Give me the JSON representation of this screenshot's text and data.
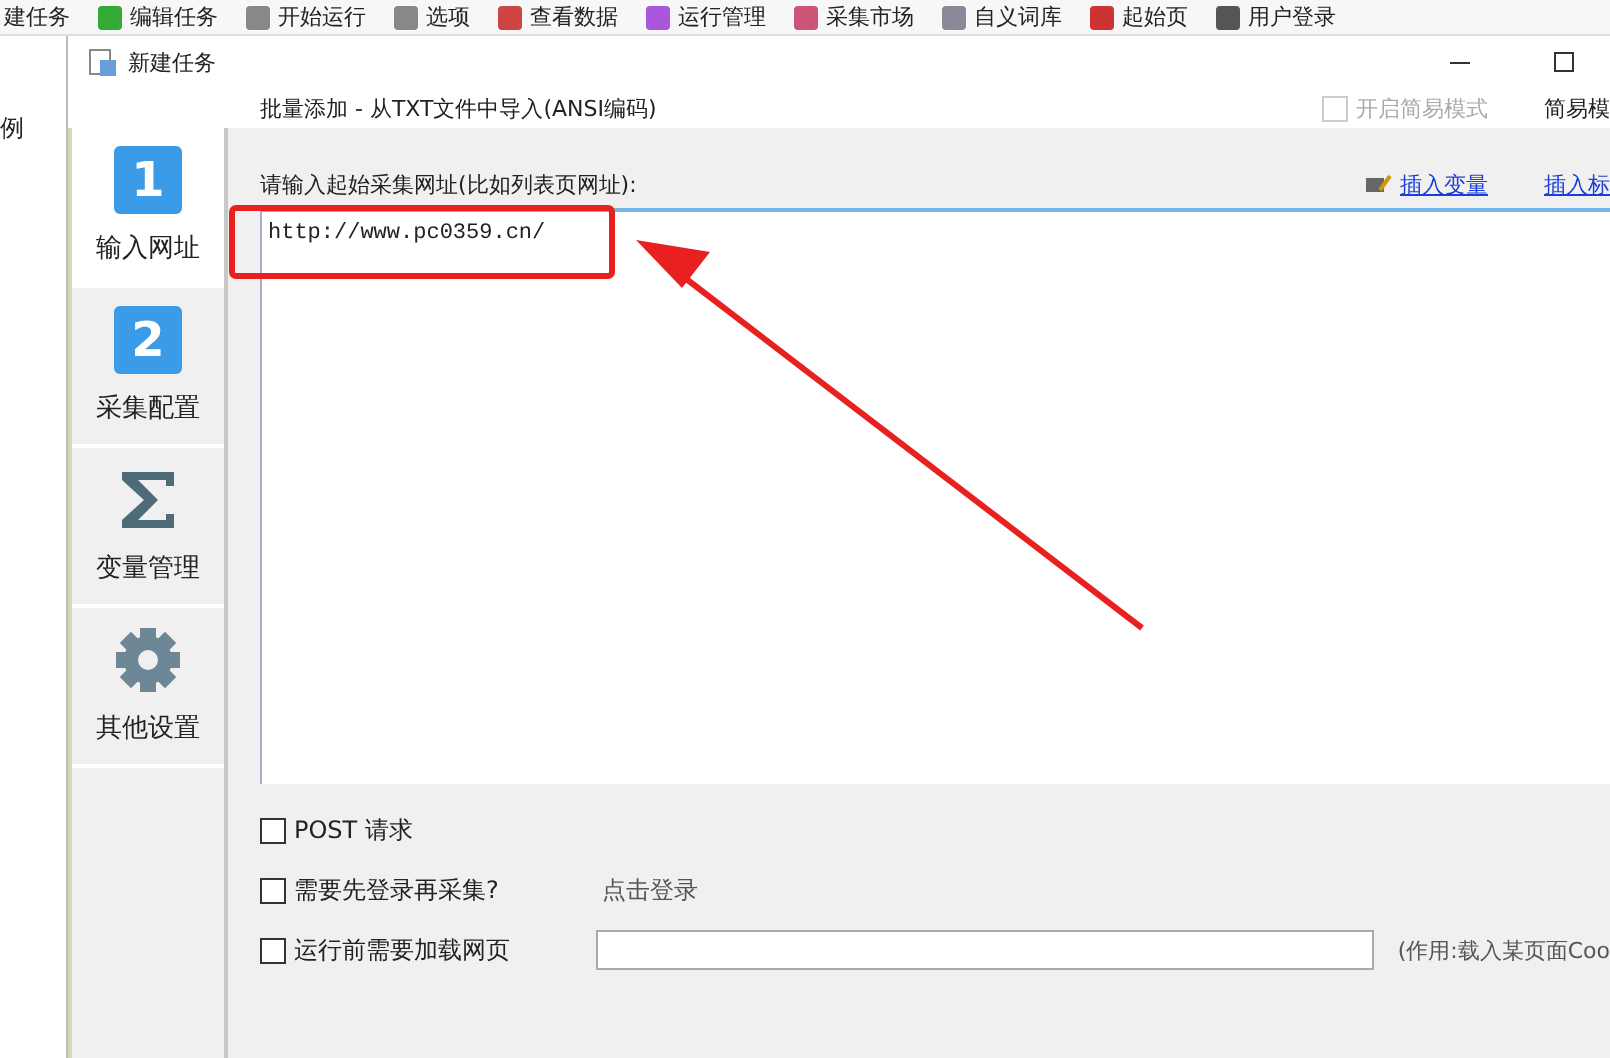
{
  "app_toolbar": {
    "items": [
      {
        "label": "建任务"
      },
      {
        "label": "编辑任务"
      },
      {
        "label": "开始运行"
      },
      {
        "label": "选项"
      },
      {
        "label": "查看数据"
      },
      {
        "label": "运行管理"
      },
      {
        "label": "采集市场"
      },
      {
        "label": "自义词库"
      },
      {
        "label": "起始页"
      },
      {
        "label": "用户登录"
      }
    ]
  },
  "left_panel": {
    "text": "例"
  },
  "dialog": {
    "title": "新建任务",
    "batch_add": "批量添加 - 从TXT文件中导入(ANSI编码)",
    "simple_mode": {
      "label": "开启简易模式",
      "checked": false,
      "disabled": true
    },
    "simple_mode_button": "简易模",
    "nav": [
      {
        "label": "输入网址",
        "kind": "number",
        "icon": "1",
        "selected": true
      },
      {
        "label": "采集配置",
        "kind": "number",
        "icon": "2",
        "selected": false
      },
      {
        "label": "变量管理",
        "kind": "sigma",
        "selected": false
      },
      {
        "label": "其他设置",
        "kind": "gear",
        "selected": false
      }
    ],
    "url_label": "请输入起始采集网址(比如列表页网址):",
    "links": [
      "插入变量",
      "插入标"
    ],
    "urls": "http://www.pc0359.cn/",
    "options": [
      {
        "kind": "plain",
        "label": "POST 请求",
        "checked": false
      },
      {
        "kind": "action",
        "label": "需要先登录再采集?",
        "checked": false,
        "action": "点击登录"
      },
      {
        "kind": "field",
        "label": "运行前需要加载网页",
        "checked": false,
        "note": "(作用:载入某页面Coo"
      }
    ]
  },
  "annotation": {
    "kind": "callout"
  }
}
